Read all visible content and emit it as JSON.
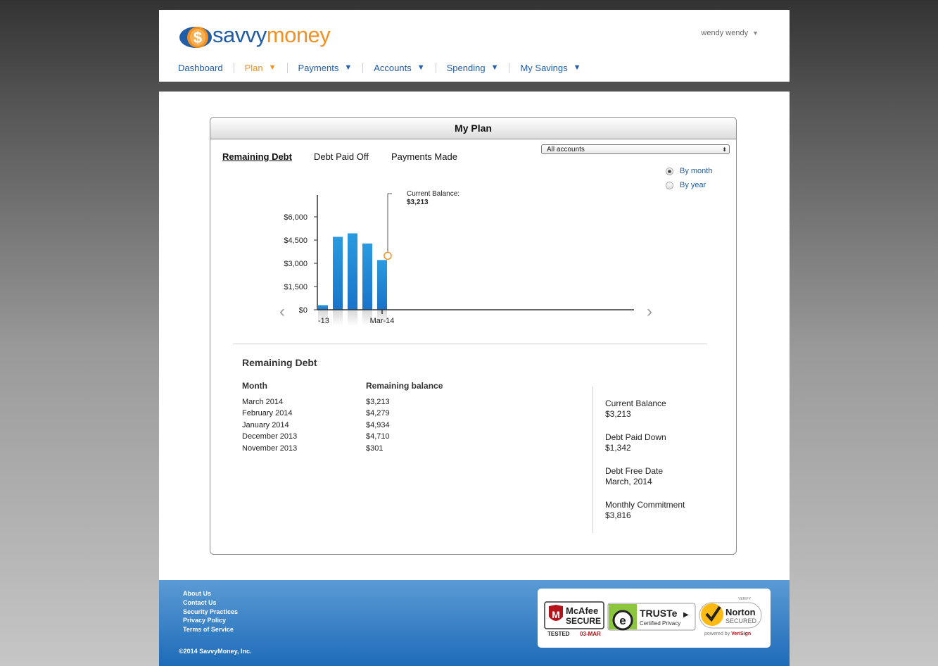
{
  "brand": {
    "logo_part1": "savvy",
    "logo_part2": "money",
    "logo_symbol": "$"
  },
  "user": {
    "name": "wendy wendy",
    "caret": "▼"
  },
  "nav": [
    {
      "label": "Dashboard",
      "arrow": ""
    },
    {
      "label": "Plan",
      "arrow": "▼"
    },
    {
      "label": "Payments",
      "arrow": "▼"
    },
    {
      "label": "Accounts",
      "arrow": "▼"
    },
    {
      "label": "Spending",
      "arrow": "▼"
    },
    {
      "label": "My Savings",
      "arrow": "▼"
    }
  ],
  "panel": {
    "title": "My Plan",
    "tabs": [
      "Remaining Debt",
      "Debt Paid Off",
      "Payments Made"
    ],
    "account_select": "All accounts",
    "radio_month": "By month",
    "radio_year": "By year",
    "selected_view": "By month"
  },
  "chart_data": {
    "type": "bar",
    "categories": [
      "Nov-13",
      "Dec-13",
      "Jan-14",
      "Feb-14",
      "Mar-14"
    ],
    "visible_tick_labels": [
      "-13",
      "Mar-14"
    ],
    "values": [
      301,
      4710,
      4934,
      4279,
      3213
    ],
    "yticks": [
      "$0",
      "$1,500",
      "$3,000",
      "$4,500",
      "$6,000"
    ],
    "ylim": [
      0,
      7000
    ],
    "callout": {
      "label": "Current Balance:",
      "value": "$3,213"
    },
    "bar_color": "#1a73c9",
    "nav_prev": "‹",
    "nav_next": "›"
  },
  "remaining": {
    "title": "Remaining Debt",
    "col_month": "Month",
    "col_balance": "Remaining balance",
    "rows": [
      {
        "month": "March 2014",
        "balance": "$3,213"
      },
      {
        "month": "February 2014",
        "balance": "$4,279"
      },
      {
        "month": "January 2014",
        "balance": "$4,934"
      },
      {
        "month": "December 2013",
        "balance": "$4,710"
      },
      {
        "month": "November 2013",
        "balance": "$301"
      }
    ]
  },
  "stats": [
    {
      "label": "Current Balance",
      "value": "$3,213"
    },
    {
      "label": "Debt Paid Down",
      "value": "$1,342"
    },
    {
      "label": "Debt Free Date",
      "value": "March, 2014"
    },
    {
      "label": "Monthly Commitment",
      "value": "$3,816"
    }
  ],
  "footer": {
    "links": [
      "About Us",
      "Contact Us",
      "Security Practices",
      "Privacy Policy",
      "Terms of Service"
    ],
    "copyright": "©2014 SavvyMoney, Inc."
  },
  "seals": {
    "mcafee": {
      "line1": "McAfee",
      "line2": "SECURE",
      "tested": "TESTED",
      "date": "03-MAR"
    },
    "truste": {
      "name": "TRUSTe",
      "arrow": "▶",
      "sub": "Certified Privacy"
    },
    "norton": {
      "top": "VERIFY",
      "name": "Norton",
      "secured": "SECURED",
      "powered": "powered by ",
      "verisign": "VeriSign"
    }
  },
  "colors": {
    "brand_blue": "#1f5da6",
    "brand_orange": "#f29122",
    "footer_blue": "#2a78c3"
  }
}
